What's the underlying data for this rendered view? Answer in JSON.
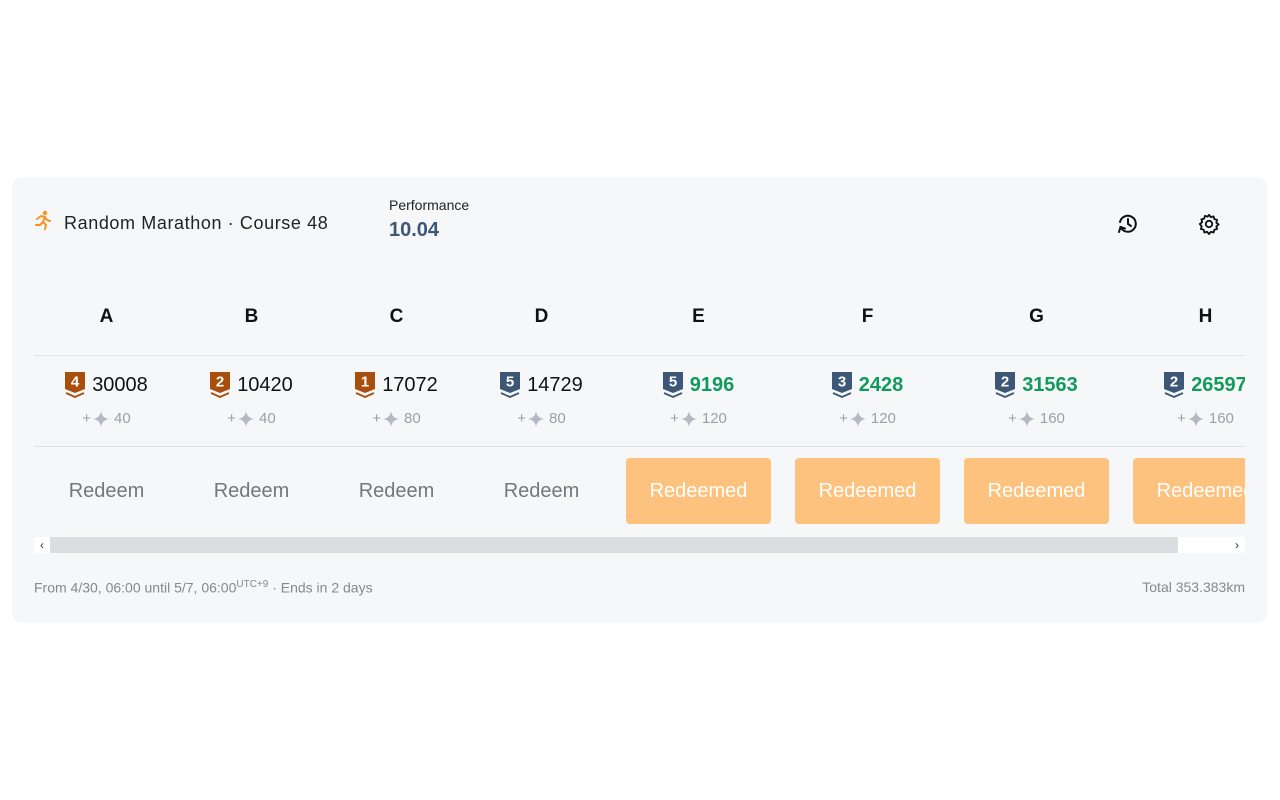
{
  "header": {
    "title": "Random Marathon · Course 48",
    "title_icon": "runner-icon",
    "accent": "#f7931e",
    "performance_label": "Performance",
    "performance_value": "10.04"
  },
  "actions": {
    "history_icon": "history-icon",
    "settings_icon": "gear-icon"
  },
  "columns": [
    {
      "label": "A",
      "rank": "4",
      "badge": "bronze",
      "score": "30008",
      "bonus": "40",
      "button": "Redeem",
      "redeemed": false
    },
    {
      "label": "B",
      "rank": "2",
      "badge": "bronze",
      "score": "10420",
      "bonus": "40",
      "button": "Redeem",
      "redeemed": false
    },
    {
      "label": "C",
      "rank": "1",
      "badge": "bronze",
      "score": "17072",
      "bonus": "80",
      "button": "Redeem",
      "redeemed": false
    },
    {
      "label": "D",
      "rank": "5",
      "badge": "slate",
      "score": "14729",
      "bonus": "80",
      "button": "Redeem",
      "redeemed": false
    },
    {
      "label": "E",
      "rank": "5",
      "badge": "slate",
      "score": "9196",
      "bonus": "120",
      "button": "Redeemed",
      "redeemed": true
    },
    {
      "label": "F",
      "rank": "3",
      "badge": "slate",
      "score": "2428",
      "bonus": "120",
      "button": "Redeemed",
      "redeemed": true
    },
    {
      "label": "G",
      "rank": "2",
      "badge": "slate",
      "score": "31563",
      "bonus": "160",
      "button": "Redeemed",
      "redeemed": true
    },
    {
      "label": "H",
      "rank": "2",
      "badge": "slate",
      "score": "26597",
      "bonus": "160",
      "button": "Redeemed",
      "redeemed": true
    }
  ],
  "colors": {
    "bronze": "#a94f0d",
    "slate": "#3d5877",
    "green": "#129a5c",
    "redeemed_bg": "#fdc27d"
  },
  "bonus_prefix": "+",
  "footer": {
    "period": "From 4/30, 06:00 until 5/7, 06:00",
    "tz": "UTC+9",
    "ends": " · Ends in 2 days",
    "total": "Total 353.383km"
  }
}
